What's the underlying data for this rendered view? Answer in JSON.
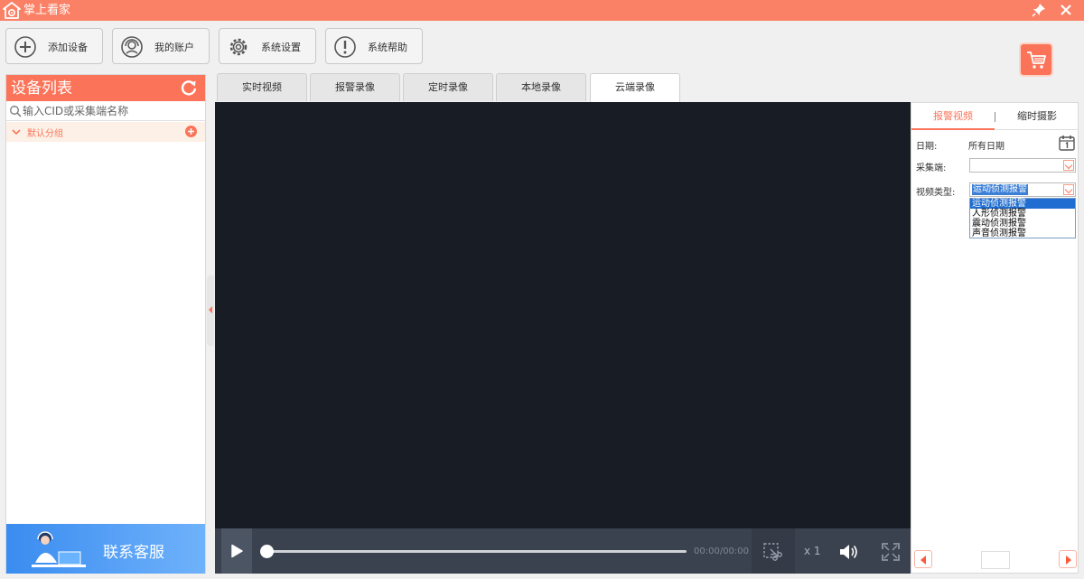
{
  "app": {
    "title": "掌上看家"
  },
  "toolbar": {
    "add_device": "添加设备",
    "my_account": "我的账户",
    "system_settings": "系统设置",
    "system_help": "系统帮助"
  },
  "device_panel": {
    "title": "设备列表",
    "search_placeholder": "输入CID或采集端名称",
    "default_group": "默认分组",
    "customer_service": "联系客服"
  },
  "tabs": [
    "实时视频",
    "报警录像",
    "定时录像",
    "本地录像",
    "云端录像"
  ],
  "active_tab": "云端录像",
  "player": {
    "time": "00:00/00:00",
    "speed": "x 1",
    "progress": 0
  },
  "right_panel": {
    "tabs": [
      "报警视频",
      "缩时摄影"
    ],
    "date_label": "日期:",
    "date_value": "所有日期",
    "collector_label": "采集端:",
    "collector_value": "",
    "video_type_label": "视频类型:",
    "video_type_value": "运动侦测报警",
    "video_type_options": [
      "运动侦测报警",
      "人形侦测报警",
      "震动侦测报警",
      "声音侦测报警"
    ]
  },
  "colors": {
    "accent": "#fb7459",
    "video_bg": "#181c24",
    "service_blue": "#3a8cf0"
  },
  "icons": {
    "app_logo": "house-camera-icon",
    "pin": "pin-icon",
    "close": "close-icon",
    "add": "plus-circle-icon",
    "account": "headset-user-icon",
    "settings": "gear-icon",
    "help": "exclamation-circle-icon",
    "cart": "shopping-cart-icon",
    "refresh": "refresh-icon",
    "search": "search-icon",
    "calendar": "calendar-icon",
    "play": "play-icon",
    "clip": "clip-scissors-icon",
    "volume": "volume-icon",
    "fullscreen": "fullscreen-icon"
  }
}
